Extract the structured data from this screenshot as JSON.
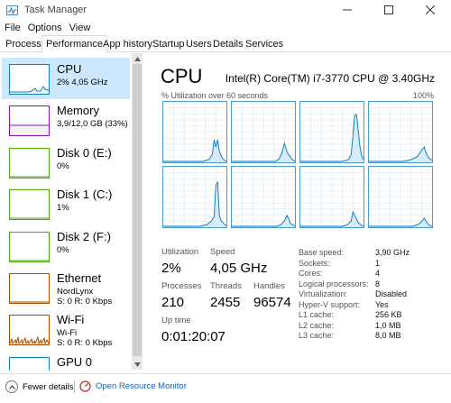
{
  "window": {
    "title": "Task Manager",
    "controls": {
      "minimize": "—",
      "maximize": "☐",
      "close": "✕"
    }
  },
  "menu": [
    "File",
    "Options",
    "View"
  ],
  "tabs": [
    "Processes",
    "Performance",
    "App history",
    "Startup",
    "Users",
    "Details",
    "Services"
  ],
  "active_tab": "Performance",
  "sidebar": {
    "items": [
      {
        "name": "CPU",
        "sub": "2% 4,05 GHz",
        "sub2": "",
        "color": "#117dbb",
        "fill": "#f1f6fa"
      },
      {
        "name": "Memory",
        "sub": "3,9/12,0 GB (33%)",
        "sub2": "",
        "color": "#8b12ae",
        "fill": "#f4f2f4"
      },
      {
        "name": "Disk 0 (E:)",
        "sub": "0%",
        "sub2": "",
        "color": "#4da60c",
        "fill": "#eff7e9"
      },
      {
        "name": "Disk 1 (C:)",
        "sub": "1%",
        "sub2": "",
        "color": "#4da60c",
        "fill": "#eff7e9"
      },
      {
        "name": "Disk 2 (F:)",
        "sub": "0%",
        "sub2": "",
        "color": "#4da60c",
        "fill": "#eff7e9"
      },
      {
        "name": "Ethernet",
        "sub": "NordLynx",
        "sub2": "S: 0 R: 0 Kbps",
        "color": "#a74f01",
        "fill": "#fcf3eb"
      },
      {
        "name": "Wi-Fi",
        "sub": "Wi-Fi",
        "sub2": "S: 0 R: 0 Kbps",
        "color": "#a74f01",
        "fill": "#fcf3eb"
      },
      {
        "name": "GPU 0",
        "sub": "",
        "sub2": "",
        "color": "#117dbb",
        "fill": "#f1f6fa"
      }
    ]
  },
  "main": {
    "title": "CPU",
    "processor": "Intel(R) Core(TM) i7-3770 CPU @ 3.40GHz",
    "graph_label": "% Utilization over 60 seconds",
    "graph_max": "100%",
    "stats": {
      "utilization": {
        "label": "Utilization",
        "value": "2%"
      },
      "speed": {
        "label": "Speed",
        "value": "4,05 GHz"
      },
      "processes": {
        "label": "Processes",
        "value": "210"
      },
      "threads": {
        "label": "Threads",
        "value": "2455"
      },
      "handles": {
        "label": "Handles",
        "value": "96574"
      },
      "uptime": {
        "label": "Up time",
        "value": "0:01:20:07"
      }
    },
    "details": [
      {
        "label": "Base speed:",
        "value": "3,90 GHz"
      },
      {
        "label": "Sockets:",
        "value": "1"
      },
      {
        "label": "Cores:",
        "value": "4"
      },
      {
        "label": "Logical processors:",
        "value": "8"
      },
      {
        "label": "Virtualization:",
        "value": "Disabled"
      },
      {
        "label": "Hyper-V support:",
        "value": "Yes"
      },
      {
        "label": "L1 cache:",
        "value": "256 KB"
      },
      {
        "label": "L2 cache:",
        "value": "1,0 MB"
      },
      {
        "label": "L3 cache:",
        "value": "8,0 MB"
      }
    ]
  },
  "footer": {
    "fewer_details": "Fewer details",
    "resource_monitor": "Open Resource Monitor"
  },
  "theme": {
    "accent": "#117dbb",
    "graph_line": "#117dbb",
    "graph_fill": "#d9ebf7",
    "grid": "#d9eaf4",
    "link": "#1a5fb4"
  }
}
